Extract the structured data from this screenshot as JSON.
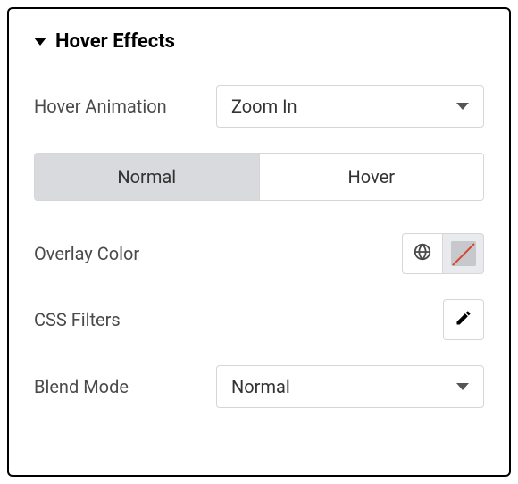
{
  "section": {
    "title": "Hover Effects"
  },
  "hoverAnimation": {
    "label": "Hover Animation",
    "value": "Zoom In"
  },
  "tabs": {
    "normal": "Normal",
    "hover": "Hover"
  },
  "overlayColor": {
    "label": "Overlay Color"
  },
  "cssFilters": {
    "label": "CSS Filters"
  },
  "blendMode": {
    "label": "Blend Mode",
    "value": "Normal"
  }
}
